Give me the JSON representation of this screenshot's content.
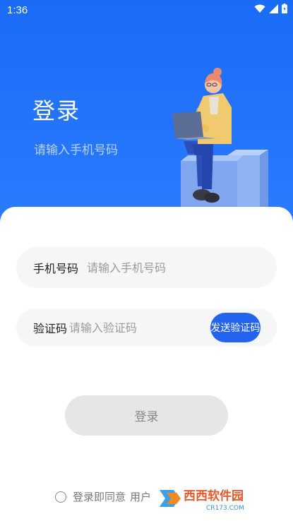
{
  "status_bar": {
    "time": "1:36"
  },
  "hero": {
    "title": "登录",
    "subtitle": "请输入手机号码"
  },
  "form": {
    "phone": {
      "label": "手机号码",
      "placeholder": "请输入手机号码"
    },
    "code": {
      "label": "验证码",
      "placeholder": "请输入验证码",
      "send_label": "发送验证码"
    },
    "login_label": "登录"
  },
  "agreement": {
    "text": "登录即同意",
    "link": "用户"
  },
  "watermark": {
    "text": "西西软件园",
    "domain": "CR173.COM"
  },
  "colors": {
    "primary": "#2463ee",
    "hero_bg": "#1a6cf6"
  }
}
